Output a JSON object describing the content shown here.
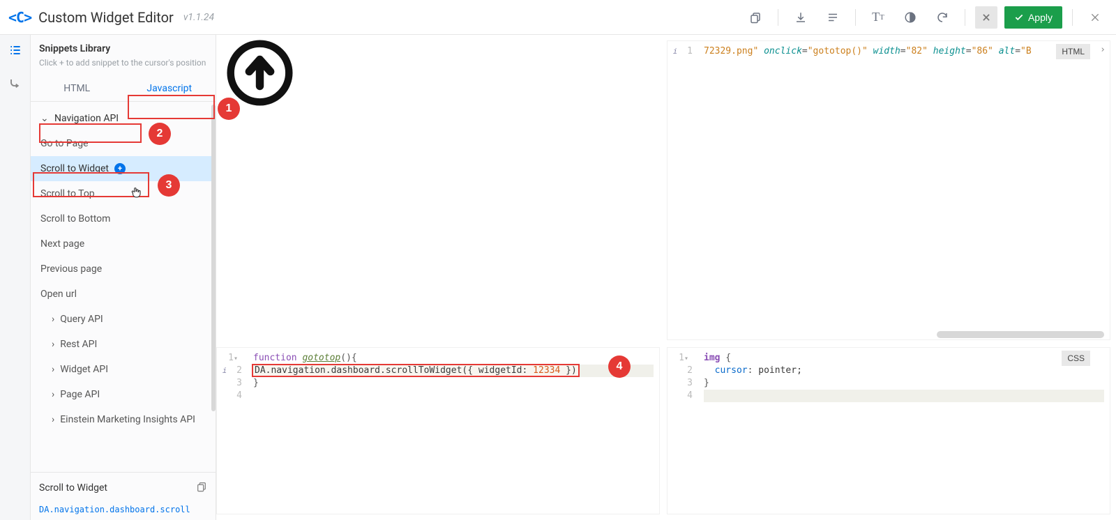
{
  "topbar": {
    "logo": "<C>",
    "title": "Custom Widget Editor",
    "version": "v1.1.24",
    "apply": "Apply"
  },
  "sidebar": {
    "title": "Snippets Library",
    "hint": "Click + to add snippet to the cursor's position",
    "tabs": {
      "html": "HTML",
      "js": "Javascript"
    },
    "group_nav": "Navigation API",
    "items": {
      "goto": "Go to Page",
      "scrollwidget": "Scroll to Widget",
      "scrolltop": "Scroll to Top",
      "scrollbottom": "Scroll to Bottom",
      "nextpage": "Next page",
      "prevpage": "Previous page",
      "openurl": "Open url"
    },
    "groups": {
      "query": "Query API",
      "rest": "Rest API",
      "widget": "Widget API",
      "page": "Page API",
      "einstein": "Einstein Marketing Insights API"
    },
    "footer": {
      "title": "Scroll to Widget",
      "code": "DA.navigation.dashboard.scroll"
    }
  },
  "callouts": {
    "c1": "1",
    "c2": "2",
    "c3": "3",
    "c4": "4"
  },
  "panes": {
    "html": {
      "lang": "HTML",
      "line1_a": "72329.png\"",
      "line1_onclick": "onclick",
      "line1_eq": "=",
      "line1_val": "\"gototop()\"",
      "line1_width": "width",
      "line1_wv": "\"82\"",
      "line1_height": "height",
      "line1_hv": "\"86\"",
      "line1_alt": "alt",
      "line1_altv": "\"B"
    },
    "js": {
      "kw_fn": "function",
      "fn_name": "gototop",
      "parens": "(){",
      "line2": "DA.navigation.dashboard.scrollToWidget({ widgetId: ",
      "num": "12334",
      "line2_end": " })",
      "close": "}"
    },
    "css": {
      "lang": "CSS",
      "sel": "img",
      "open": " {",
      "prop": "cursor",
      "colon": ": ",
      "val": "pointer;",
      "close": "}"
    }
  }
}
